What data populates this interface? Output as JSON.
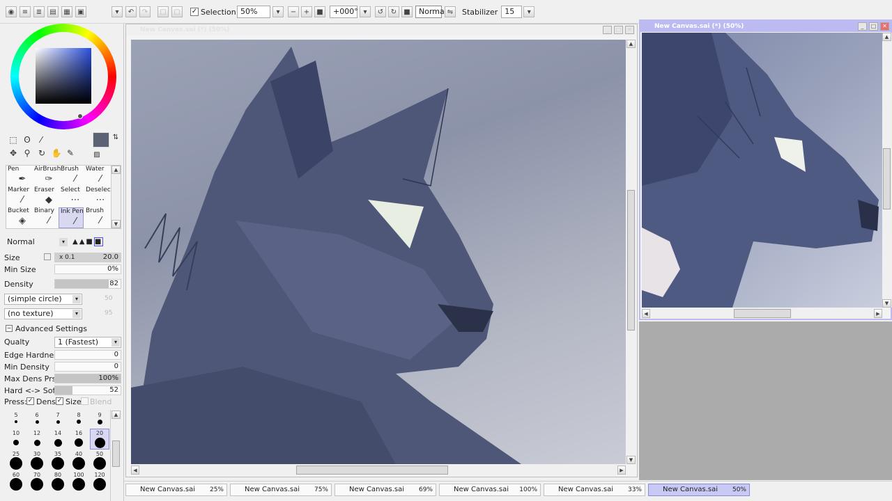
{
  "toolbar": {
    "selection_label": "Selection",
    "selection_checked": true,
    "zoom_value": "50%",
    "rotation_value": "+000°",
    "blend_mode": "Normal",
    "stabilizer_label": "Stabilizer",
    "stabilizer_value": "15"
  },
  "colors": {
    "current_color": "#5b6275",
    "accent": "#c9c9f5",
    "canvas_header": "#bbbbf2"
  },
  "tools": [
    {
      "label": "Pen",
      "icon": "pen-icon"
    },
    {
      "label": "AirBrush",
      "icon": "airbrush-icon"
    },
    {
      "label": "Brush",
      "icon": "brush-icon"
    },
    {
      "label": "Water",
      "icon": "water-icon"
    },
    {
      "label": "Marker",
      "icon": "marker-icon"
    },
    {
      "label": "Eraser",
      "icon": "eraser-icon"
    },
    {
      "label": "Select",
      "icon": "select-icon"
    },
    {
      "label": "Deselect",
      "icon": "deselect-icon"
    },
    {
      "label": "Bucket",
      "icon": "bucket-icon"
    },
    {
      "label": "Binary",
      "icon": "binary-icon"
    },
    {
      "label": "Ink Pen",
      "icon": "ink-pen-icon"
    },
    {
      "label": "Brush",
      "icon": "brush-icon"
    }
  ],
  "brush": {
    "mode": "Normal",
    "size_label": "Size",
    "size_multiplier": "x 0.1",
    "size_value": "20.0",
    "min_size_label": "Min Size",
    "min_size_value": "0%",
    "density_label": "Density",
    "density_value": "82",
    "shape": "(simple circle)",
    "shape_amount": "50",
    "texture": "(no texture)",
    "texture_amount": "95"
  },
  "advanced": {
    "title": "Advanced Settings",
    "quality_label": "Qualty",
    "quality_value": "1 (Fastest)",
    "edge_hardness_label": "Edge Hardness",
    "edge_hardness_value": "0",
    "min_density_label": "Min Density",
    "min_density_value": "0",
    "max_dens_label": "Max Dens Prs.",
    "max_dens_value": "100%",
    "hard_soft_label": "Hard <-> Soft",
    "hard_soft_value": "52",
    "press_label": "Press:",
    "dens_label": "Dens",
    "size_label": "Size",
    "blend_label": "Blend"
  },
  "brush_sizes": [
    "5",
    "6",
    "7",
    "8",
    "9",
    "10",
    "12",
    "14",
    "16",
    "20",
    "25",
    "30",
    "35",
    "40",
    "50",
    "60",
    "70",
    "80",
    "100",
    "120"
  ],
  "selected_brush_size": "20",
  "main_canvas": {
    "title": "New Canvas.sai (*) (50%)"
  },
  "nav_canvas": {
    "title": "New Canvas.sai (*) (50%)"
  },
  "canvas_tabs": [
    {
      "name": "New Canvas.sai",
      "zoom": "25%"
    },
    {
      "name": "New Canvas.sai",
      "zoom": "75%"
    },
    {
      "name": "New Canvas.sai",
      "zoom": "69%"
    },
    {
      "name": "New Canvas.sai",
      "zoom": "100%"
    },
    {
      "name": "New Canvas.sai",
      "zoom": "33%"
    },
    {
      "name": "New Canvas.sai",
      "zoom": "50%"
    }
  ]
}
